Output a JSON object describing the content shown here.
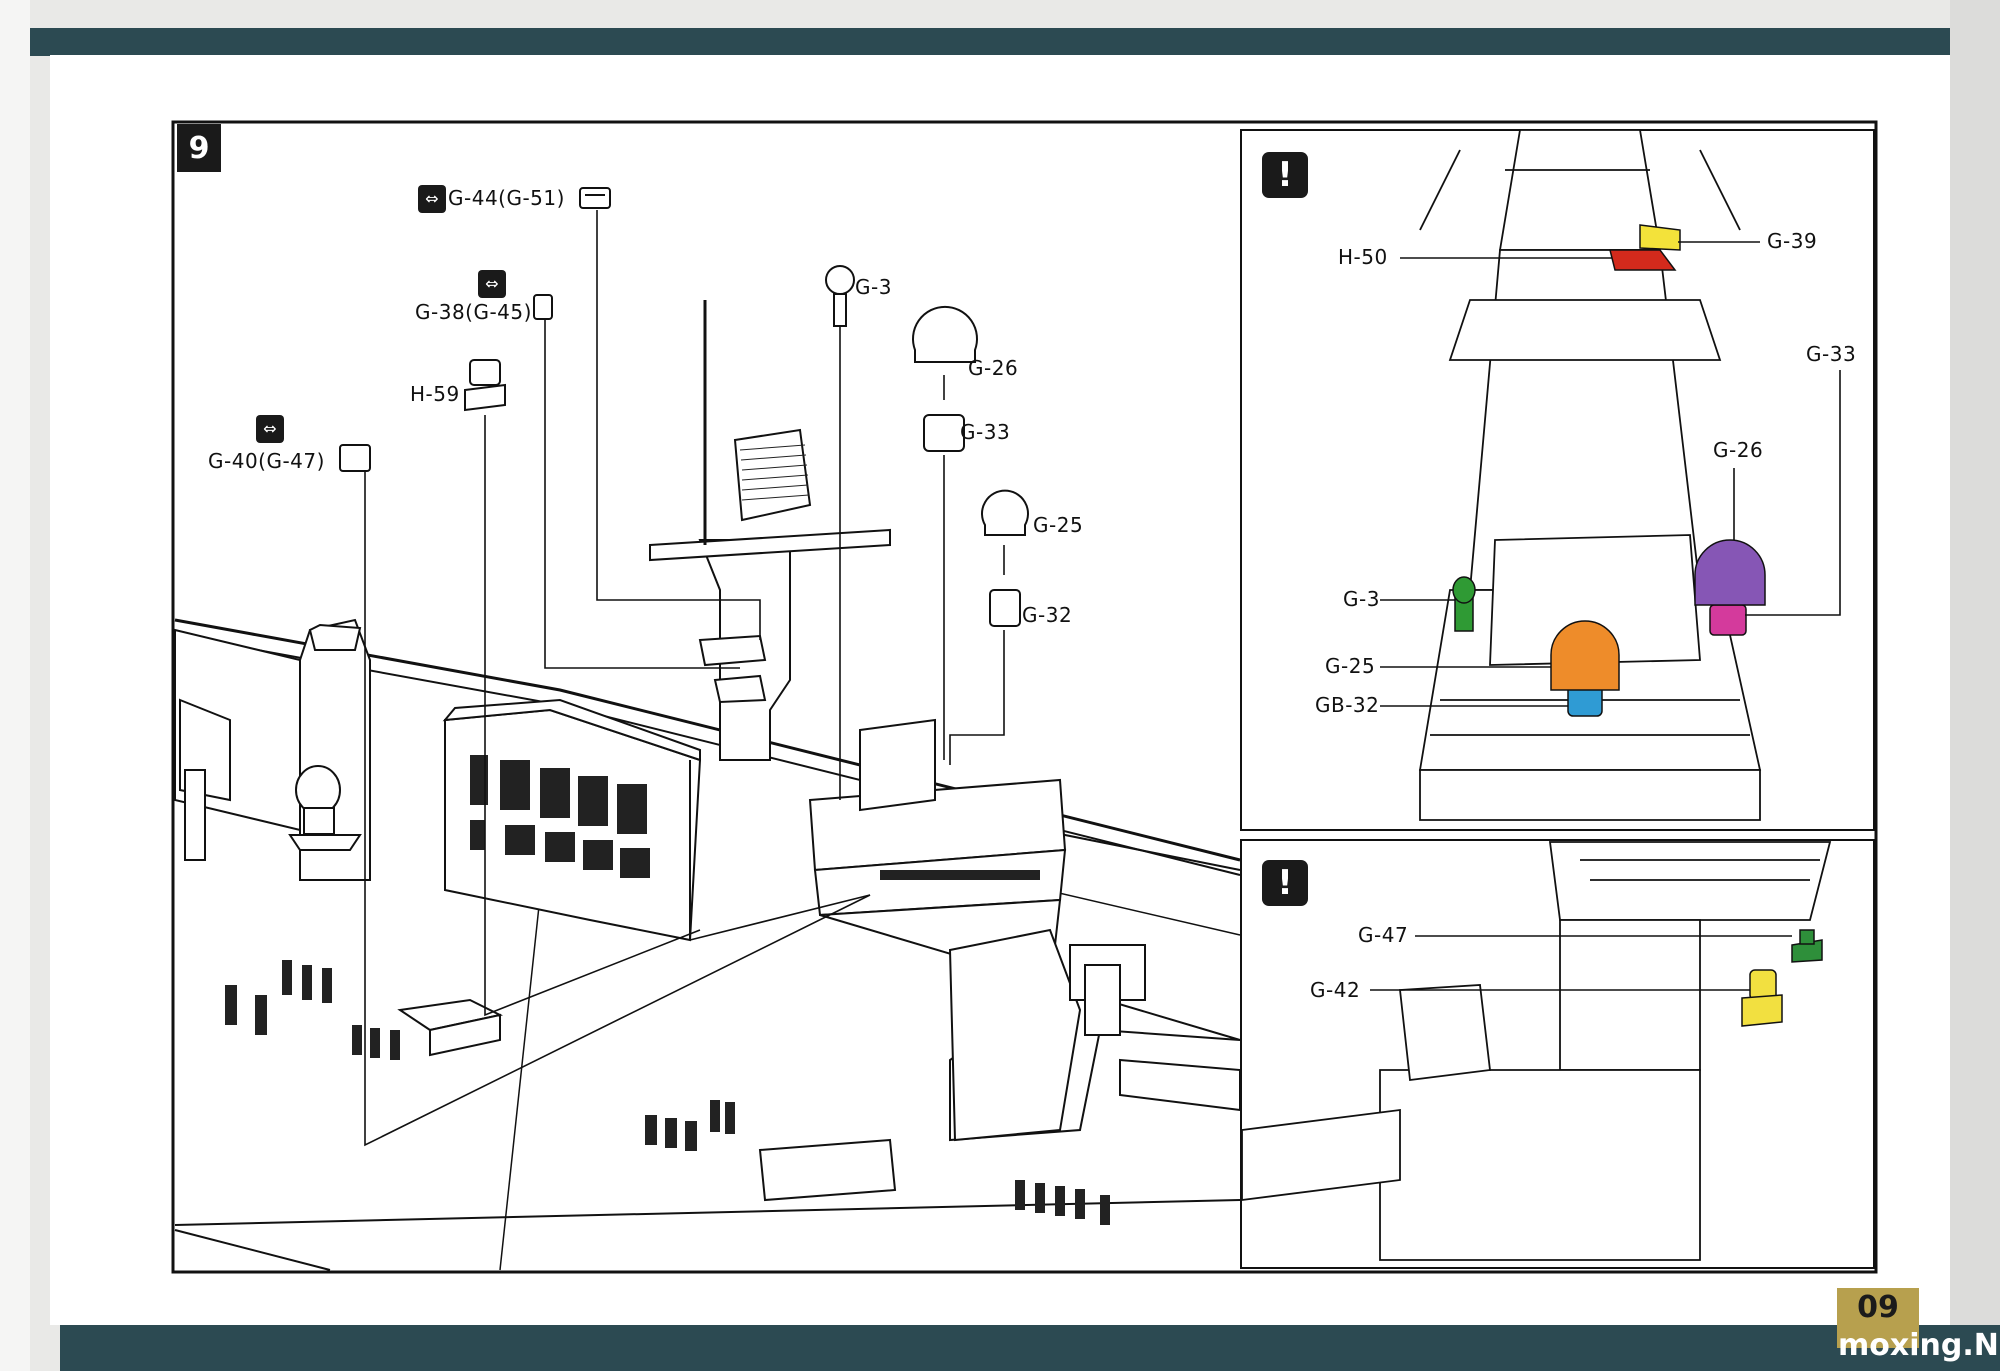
{
  "step": {
    "number": "9"
  },
  "main_callouts": {
    "g44": "G-44(G-51)",
    "g38": "G-38(G-45)",
    "g3": "G-3",
    "g26": "G-26",
    "g33": "G-33",
    "h59": "H-59",
    "g40": "G-40(G-47)",
    "g25": "G-25",
    "g32": "G-32"
  },
  "detail_top": {
    "h50": "H-50",
    "g39": "G-39",
    "g33": "G-33",
    "g26": "G-26",
    "g3": "G-3",
    "g25": "G-25",
    "gb32": "GB-32"
  },
  "detail_bottom": {
    "g47": "G-47",
    "g42": "G-42"
  },
  "warning_symbol": "!",
  "page_number": "09",
  "watermark": "moxing.NET",
  "part_colors": {
    "H-50": "#d32a1c",
    "G-39": "#f3e23a",
    "G-26": "#8656b5",
    "G-33": "#d43a9c",
    "G-3": "#2f9a34",
    "G-25": "#ee8c2a",
    "GB-32": "#2f9bd4",
    "G-47": "#2e8f3a",
    "G-42": "#f2e040"
  },
  "icons": [
    "mirror-part-icon",
    "warning-icon"
  ]
}
